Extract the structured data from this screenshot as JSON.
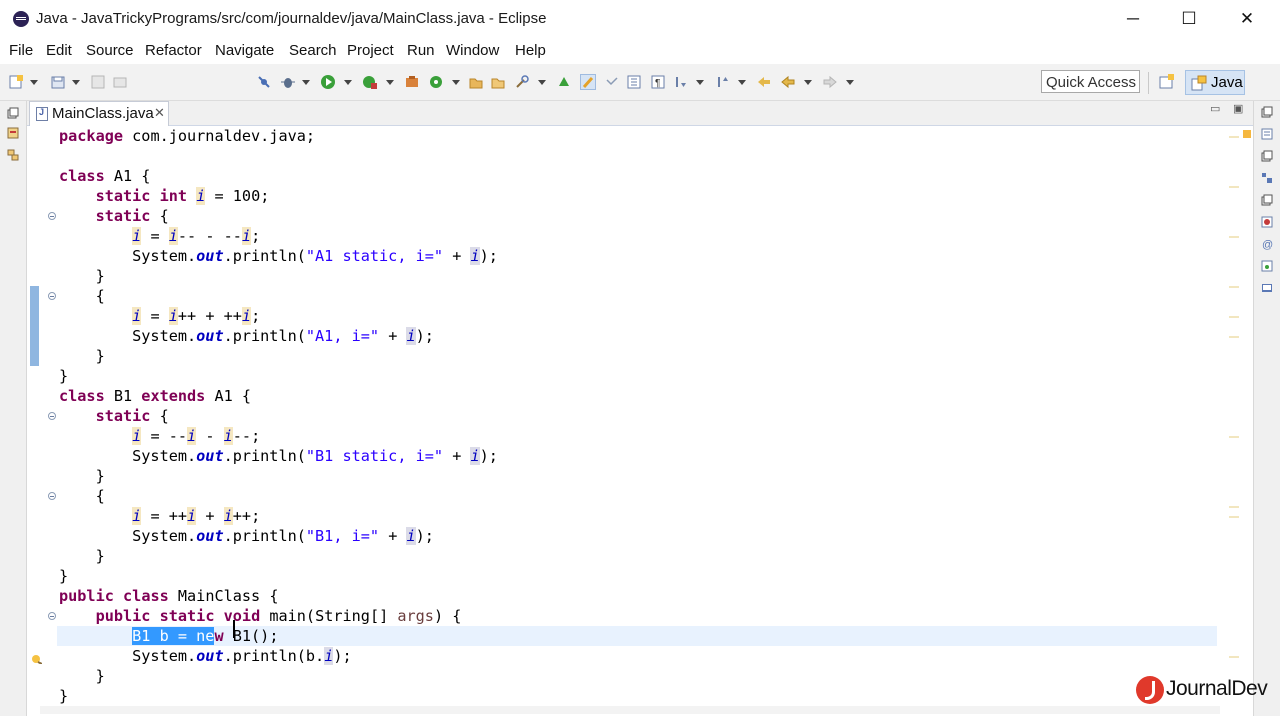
{
  "window": {
    "title": "Java - JavaTrickyPrograms/src/com/journaldev/java/MainClass.java - Eclipse",
    "minimize": "─",
    "maximize": "☐",
    "close": "✕"
  },
  "menu": [
    "File",
    "Edit",
    "Source",
    "Refactor",
    "Navigate",
    "Search",
    "Project",
    "Run",
    "Window",
    "Help"
  ],
  "toolbar": {
    "quick_access": "Quick Access",
    "perspective": "Java"
  },
  "editor": {
    "tab_label": "MainClass.java",
    "tab_close": "✕",
    "minimize": "▭",
    "maximize": "▣"
  },
  "code": [
    "package com.journaldev.java;",
    "",
    "class A1 {",
    "    static int i = 100;",
    "    static {",
    "        i = i-- - --i;",
    "        System.out.println(\"A1 static, i=\" + i);",
    "    }",
    "    {",
    "        i = i++ + ++i;",
    "        System.out.println(\"A1, i=\" + i);",
    "    }",
    "}",
    "class B1 extends A1 {",
    "    static {",
    "        i = --i - i--;",
    "        System.out.println(\"B1 static, i=\" + i);",
    "    }",
    "    {",
    "        i = ++i + i++;",
    "        System.out.println(\"B1, i=\" + i);",
    "    }",
    "}",
    "public class MainClass {",
    "    public static void main(String[] args) {",
    "        B1 b = new B1();",
    "        System.out.println(b.i);",
    "    }",
    "}"
  ],
  "logo": {
    "text": "JournalDev",
    "color": "#e0392b"
  },
  "colors": {
    "keyword": "#7f0055",
    "string": "#2a00ff",
    "field": "#0000c0",
    "selection": "#3399ff"
  }
}
